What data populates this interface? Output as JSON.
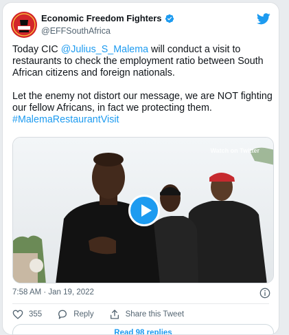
{
  "tweet": {
    "author": {
      "display_name": "Economic Freedom Fighters",
      "handle": "@EFFSouthAfrica",
      "verified": true,
      "avatar_icon": "eff-logo-icon"
    },
    "text": {
      "line1_prefix": "Today CIC ",
      "mention": "@Julius_S_Malema",
      "line1_suffix": " will conduct a visit to restaurants to check the employment ratio between South African citizens and foreign nationals.",
      "paragraph2": "Let the enemy not distort our message, we are NOT fighting our fellow Africans, in fact we protecting them.",
      "hashtag": "#MalemaRestaurantVisit"
    },
    "media": {
      "type": "video",
      "watch_label": "Watch on Twitter",
      "play_icon": "play-icon"
    },
    "timestamp": "7:58 AM · Jan 19, 2022",
    "actions": {
      "likes": "355",
      "reply_label": "Reply",
      "share_label": "Share this Tweet"
    },
    "replies_button": "Read 98 replies"
  },
  "colors": {
    "accent": "#1d9bf0",
    "eff_red": "#d3262b",
    "text": "#0f1419",
    "muted": "#536471"
  }
}
